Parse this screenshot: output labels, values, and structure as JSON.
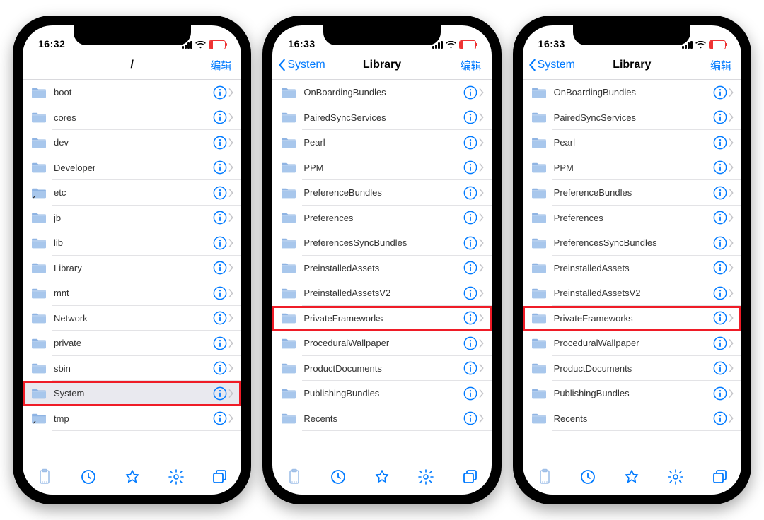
{
  "colors": {
    "accent": "#007aff",
    "highlight": "#ef1c27",
    "battery": "#e33"
  },
  "phones": [
    {
      "status_time": "16:32",
      "nav": {
        "back": null,
        "title": "/",
        "edit": "编辑"
      },
      "items": [
        {
          "name": "boot",
          "icon": "folder"
        },
        {
          "name": "cores",
          "icon": "folder"
        },
        {
          "name": "dev",
          "icon": "folder"
        },
        {
          "name": "Developer",
          "icon": "folder"
        },
        {
          "name": "etc",
          "icon": "alias"
        },
        {
          "name": "jb",
          "icon": "folder"
        },
        {
          "name": "lib",
          "icon": "folder"
        },
        {
          "name": "Library",
          "icon": "folder"
        },
        {
          "name": "mnt",
          "icon": "folder"
        },
        {
          "name": "Network",
          "icon": "folder"
        },
        {
          "name": "private",
          "icon": "folder"
        },
        {
          "name": "sbin",
          "icon": "folder"
        },
        {
          "name": "System",
          "icon": "folder",
          "selected": true,
          "highlight": true
        },
        {
          "name": "tmp",
          "icon": "alias"
        }
      ]
    },
    {
      "status_time": "16:33",
      "nav": {
        "back": "System",
        "title": "Library",
        "edit": "编辑"
      },
      "items": [
        {
          "name": "OnBoardingBundles",
          "icon": "folder"
        },
        {
          "name": "PairedSyncServices",
          "icon": "folder"
        },
        {
          "name": "Pearl",
          "icon": "folder"
        },
        {
          "name": "PPM",
          "icon": "folder"
        },
        {
          "name": "PreferenceBundles",
          "icon": "folder"
        },
        {
          "name": "Preferences",
          "icon": "folder"
        },
        {
          "name": "PreferencesSyncBundles",
          "icon": "folder"
        },
        {
          "name": "PreinstalledAssets",
          "icon": "folder"
        },
        {
          "name": "PreinstalledAssetsV2",
          "icon": "folder"
        },
        {
          "name": "PrivateFrameworks",
          "icon": "folder",
          "highlight": true
        },
        {
          "name": "ProceduralWallpaper",
          "icon": "folder"
        },
        {
          "name": "ProductDocuments",
          "icon": "folder"
        },
        {
          "name": "PublishingBundles",
          "icon": "folder"
        },
        {
          "name": "Recents",
          "icon": "folder"
        }
      ]
    },
    {
      "status_time": "16:33",
      "nav": {
        "back": "System",
        "title": "Library",
        "edit": "编辑"
      },
      "items": [
        {
          "name": "OnBoardingBundles",
          "icon": "folder"
        },
        {
          "name": "PairedSyncServices",
          "icon": "folder"
        },
        {
          "name": "Pearl",
          "icon": "folder"
        },
        {
          "name": "PPM",
          "icon": "folder"
        },
        {
          "name": "PreferenceBundles",
          "icon": "folder"
        },
        {
          "name": "Preferences",
          "icon": "folder"
        },
        {
          "name": "PreferencesSyncBundles",
          "icon": "folder"
        },
        {
          "name": "PreinstalledAssets",
          "icon": "folder"
        },
        {
          "name": "PreinstalledAssetsV2",
          "icon": "folder"
        },
        {
          "name": "PrivateFrameworks",
          "icon": "folder",
          "highlight": true
        },
        {
          "name": "ProceduralWallpaper",
          "icon": "folder"
        },
        {
          "name": "ProductDocuments",
          "icon": "folder"
        },
        {
          "name": "PublishingBundles",
          "icon": "folder"
        },
        {
          "name": "Recents",
          "icon": "folder"
        }
      ]
    }
  ],
  "tabbar_icons": [
    "clipboard",
    "clock",
    "star",
    "gear",
    "windows"
  ]
}
